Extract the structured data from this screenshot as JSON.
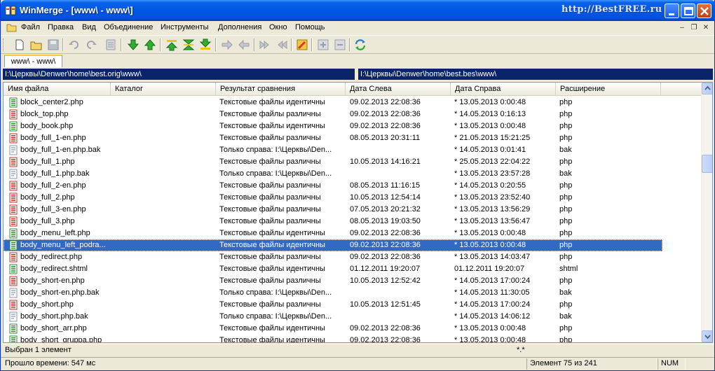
{
  "window": {
    "title": "WinMerge - [www\\ - www\\]",
    "watermark": "http://BestFREE.ru"
  },
  "menu": {
    "items": [
      "Файл",
      "Правка",
      "Вид",
      "Объединение",
      "Инструменты",
      "Дополнения",
      "Окно",
      "Помощь"
    ]
  },
  "toolbar": {
    "icons": [
      "new-icon",
      "open-icon",
      "save-icon",
      "undo-icon",
      "redo-icon",
      "options-icon",
      "next-diff-icon",
      "prev-diff-icon",
      "first-diff-icon",
      "current-diff-icon",
      "last-diff-icon",
      "copy-right-icon",
      "copy-left-icon",
      "copy-all-right-icon",
      "copy-all-left-icon",
      "open-in-editor-icon",
      "expand-icon",
      "collapse-icon",
      "refresh-icon"
    ]
  },
  "tab": {
    "label": "www\\ - www\\"
  },
  "paths": {
    "left": "I:\\Церквы\\Denwer\\home\\best.orig\\www\\",
    "right": "I:\\Церквы\\Denwer\\home\\best.bes\\www\\"
  },
  "columns": [
    "Имя файла",
    "Каталог",
    "Результат сравнения",
    "Дата Слева",
    "Дата Справа",
    "Расширение"
  ],
  "rows": [
    {
      "name": "block_center2.php",
      "dir": "",
      "result": "Текстовые файлы идентичны",
      "left": "09.02.2013 22:08:36",
      "right": "* 13.05.2013 0:00:48",
      "ext": "php",
      "icon": "identical"
    },
    {
      "name": "block_top.php",
      "dir": "",
      "result": "Текстовые файлы различны",
      "left": "09.02.2013 22:08:36",
      "right": "* 14.05.2013 0:16:13",
      "ext": "php",
      "icon": "different"
    },
    {
      "name": "body_book.php",
      "dir": "",
      "result": "Текстовые файлы идентичны",
      "left": "09.02.2013 22:08:36",
      "right": "* 13.05.2013 0:00:48",
      "ext": "php",
      "icon": "identical"
    },
    {
      "name": "body_full_1-en.php",
      "dir": "",
      "result": "Текстовые файлы различны",
      "left": "08.05.2013 20:31:11",
      "right": "* 21.05.2013 15:21:25",
      "ext": "php",
      "icon": "different"
    },
    {
      "name": "body_full_1-en.php.bak",
      "dir": "",
      "result": "Только справа: I:\\Церквы\\Den...",
      "left": "",
      "right": "* 14.05.2013 0:01:41",
      "ext": "bak",
      "icon": "right-only"
    },
    {
      "name": "body_full_1.php",
      "dir": "",
      "result": "Текстовые файлы различны",
      "left": "10.05.2013 14:16:21",
      "right": "* 25.05.2013 22:04:22",
      "ext": "php",
      "icon": "different"
    },
    {
      "name": "body_full_1.php.bak",
      "dir": "",
      "result": "Только справа: I:\\Церквы\\Den...",
      "left": "",
      "right": "* 13.05.2013 23:57:28",
      "ext": "bak",
      "icon": "right-only"
    },
    {
      "name": "body_full_2-en.php",
      "dir": "",
      "result": "Текстовые файлы различны",
      "left": "08.05.2013 11:16:15",
      "right": "* 14.05.2013 0:20:55",
      "ext": "php",
      "icon": "different"
    },
    {
      "name": "body_full_2.php",
      "dir": "",
      "result": "Текстовые файлы различны",
      "left": "10.05.2013 12:54:14",
      "right": "* 13.05.2013 23:52:40",
      "ext": "php",
      "icon": "different"
    },
    {
      "name": "body_full_3-en.php",
      "dir": "",
      "result": "Текстовые файлы различны",
      "left": "07.05.2013 20:21:32",
      "right": "* 13.05.2013 13:56:29",
      "ext": "php",
      "icon": "different"
    },
    {
      "name": "body_full_3.php",
      "dir": "",
      "result": "Текстовые файлы различны",
      "left": "08.05.2013 19:03:50",
      "right": "* 13.05.2013 13:56:47",
      "ext": "php",
      "icon": "different"
    },
    {
      "name": "body_menu_left.php",
      "dir": "",
      "result": "Текстовые файлы идентичны",
      "left": "09.02.2013 22:08:36",
      "right": "* 13.05.2013 0:00:48",
      "ext": "php",
      "icon": "identical"
    },
    {
      "name": "body_menu_left_podra...",
      "dir": "",
      "result": "Текстовые файлы идентичны",
      "left": "09.02.2013 22:08:36",
      "right": "* 13.05.2013 0:00:48",
      "ext": "php",
      "icon": "identical",
      "selected": true
    },
    {
      "name": "body_redirect.php",
      "dir": "",
      "result": "Текстовые файлы различны",
      "left": "09.02.2013 22:08:36",
      "right": "* 13.05.2013 14:03:47",
      "ext": "php",
      "icon": "different"
    },
    {
      "name": "body_redirect.shtml",
      "dir": "",
      "result": "Текстовые файлы идентичны",
      "left": "01.12.2011 19:20:07",
      "right": "01.12.2011 19:20:07",
      "ext": "shtml",
      "icon": "identical"
    },
    {
      "name": "body_short-en.php",
      "dir": "",
      "result": "Текстовые файлы различны",
      "left": "10.05.2013 12:52:42",
      "right": "* 14.05.2013 17:00:24",
      "ext": "php",
      "icon": "different"
    },
    {
      "name": "body_short-en.php.bak",
      "dir": "",
      "result": "Только справа: I:\\Церквы\\Den...",
      "left": "",
      "right": "* 14.05.2013 11:30:05",
      "ext": "bak",
      "icon": "right-only"
    },
    {
      "name": "body_short.php",
      "dir": "",
      "result": "Текстовые файлы различны",
      "left": "10.05.2013 12:51:45",
      "right": "* 14.05.2013 17:00:24",
      "ext": "php",
      "icon": "different"
    },
    {
      "name": "body_short.php.bak",
      "dir": "",
      "result": "Только справа: I:\\Церквы\\Den...",
      "left": "",
      "right": "* 14.05.2013 14:06:12",
      "ext": "bak",
      "icon": "right-only"
    },
    {
      "name": "body_short_arr.php",
      "dir": "",
      "result": "Текстовые файлы идентичны",
      "left": "09.02.2013 22:08:36",
      "right": "* 13.05.2013 0:00:48",
      "ext": "php",
      "icon": "identical"
    },
    {
      "name": "body_short_gruppa.php",
      "dir": "",
      "result": "Текстовые файлы идентичны",
      "left": "09.02.2013 22:08:36",
      "right": "* 13.05.2013 0:00:48",
      "ext": "php",
      "icon": "identical"
    }
  ],
  "status": {
    "selection": "Выбран 1 элемент",
    "filter": "*.*",
    "elapsed": "Прошло времени: 547 мс",
    "position": "Элемент 75 из 241",
    "numlock": "NUM"
  },
  "colors": {
    "title_bar": "#0058e6",
    "selection": "#316ac5",
    "path_bar": "#0a246a",
    "identical_icon": "#2e8b2e",
    "different_icon": "#c0302b"
  }
}
